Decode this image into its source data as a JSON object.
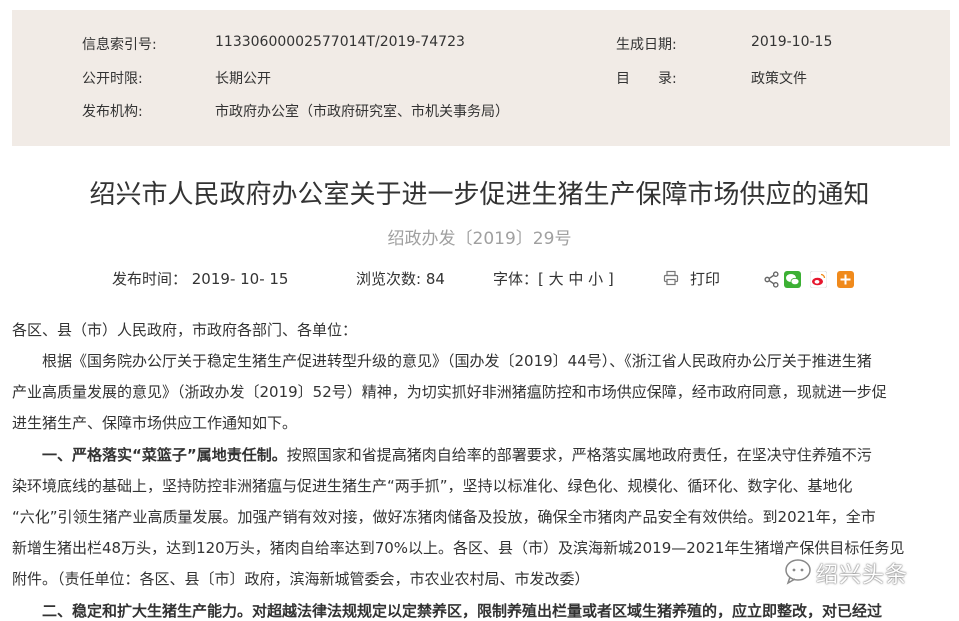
{
  "meta": {
    "index_label": "信息索引号:",
    "index_value": "11330600002577014T/2019-74723",
    "date_label": "生成日期:",
    "date_value": "2019-10-15",
    "public_label": "公开时限:",
    "public_value": "长期公开",
    "catalog_label": "目　　录:",
    "catalog_value": "政策文件",
    "issuer_label": "发布机构:",
    "issuer_value": "市政府办公室（市政府研究室、市机关事务局）"
  },
  "title": "绍兴市人民政府办公室关于进一步促进生猪生产保障市场供应的通知",
  "doc_number": "绍政办发〔2019〕29号",
  "infobar": {
    "publish_time": "发布时间： 2019- 10- 15",
    "views": "浏览次数: 84",
    "font_size": "字体：[ 大 中 小 ]",
    "print": "打印"
  },
  "body": {
    "line1": "各区、县（市）人民政府，市政府各部门、各单位：",
    "line2": "　　根据《国务院办公厅关于稳定生猪生产促进转型升级的意见》（国办发〔2019〕44号）、《浙江省人民政府办公厅关于推进生猪",
    "line3": "产业高质量发展的意见》（浙政办发〔2019〕52号）精神，为切实抓好非洲猪瘟防控和市场供应保障，经市政府同意，现就进一步促",
    "line4": "进生猪生产、保障市场供应工作通知如下。",
    "line5_bold": "　　一、严格落实“菜篮子”属地责任制。",
    "line5_rest": "按照国家和省提高猪肉自给率的部署要求，严格落实属地政府责任，在坚决守住养殖不污",
    "line6": "染环境底线的基础上，坚持防控非洲猪瘟与促进生猪生产“两手抓”，坚持以标准化、绿色化、规模化、循环化、数字化、基地化",
    "line7": "“六化”引领生猪产业高质量发展。加强产销有效对接，做好冻猪肉储备及投放，确保全市猪肉产品安全有效供给。到2021年，全市",
    "line8": "新增生猪出栏48万头，达到120万头，猪肉自给率达到70%以上。各区、县（市）及滨海新城2019—2021年生猪增产保供目标任务见",
    "line9": "附件。（责任单位：各区、县〔市〕政府，滨海新城管委会，市农业农村局、市发改委）",
    "line10": "　　二、稳定和扩大生猪生产能力。对超越法律法规规定以定禁养区，限制养殖出栏量或者区域生猪养殖的，应立即整改，对已经过"
  },
  "watermark": "绍兴头条",
  "colors": {
    "meta_bg": "#f1ebe6",
    "doc_number": "#a0a0a0",
    "wechat_green": "#3cb034",
    "weibo_red": "#e6162d",
    "plus_orange": "#f08a1c"
  }
}
